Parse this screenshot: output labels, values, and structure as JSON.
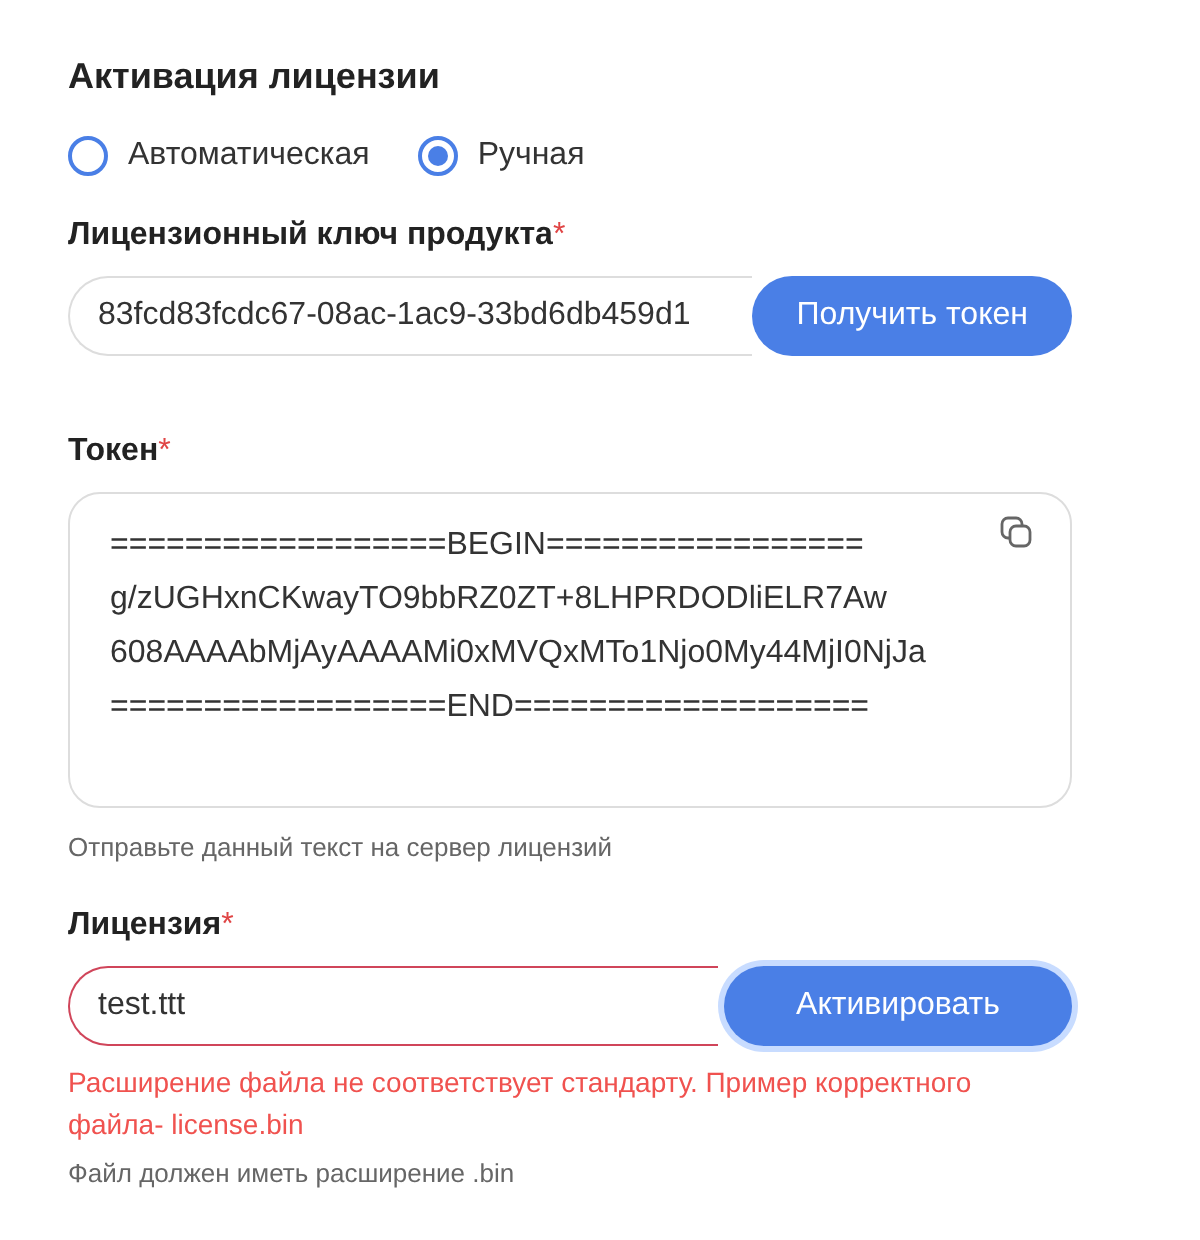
{
  "title": "Активация лицензии",
  "mode_options": [
    {
      "label": "Автоматическая",
      "selected": false
    },
    {
      "label": "Ручная",
      "selected": true
    }
  ],
  "key_field": {
    "label": "Лицензионный ключ продукта",
    "required_mark": "*",
    "value": "83fcd83fcdc67-08ac-1ac9-33bd6db459d1",
    "button": "Получить токен",
    "focused": false
  },
  "token_field": {
    "label": "Токен",
    "required_mark": "*",
    "lines": [
      "==================BEGIN=================",
      "g/zUGHxnCKwayTO9bbRZ0ZT+8LHPRDODliELR7Aw",
      "608AAAAbMjAyAAAAMi0xMVQxMTo1Njo0My44MjI0NjJa",
      "==================END==================="
    ],
    "hint": "Отправьте данный текст на сервер лицензий"
  },
  "license_field": {
    "label": "Лицензия",
    "required_mark": "*",
    "value": "test.ttt",
    "invalid": true,
    "button": "Активировать",
    "focused": true,
    "error": "Расширение файла не соответствует стандарту. Пример корректного файла- license.bin",
    "hint": "Файл должен иметь расширение .bin"
  }
}
